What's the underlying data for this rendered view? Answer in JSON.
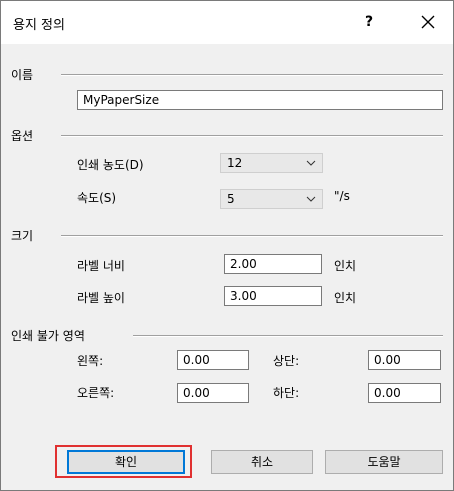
{
  "window": {
    "title": "용지 정의",
    "help_label": "?"
  },
  "name_section": {
    "title": "이름",
    "name_value": "MyPaperSize"
  },
  "options_section": {
    "title": "옵션",
    "darkness": {
      "label": "인쇄 농도(D)",
      "value": "12"
    },
    "speed": {
      "label": "속도(S)",
      "value": "5",
      "unit": "\"/s"
    }
  },
  "size_section": {
    "title": "크기",
    "width": {
      "label": "라벨 너비",
      "value": "2.00",
      "unit": "인치"
    },
    "height": {
      "label": "라벨 높이",
      "value": "3.00",
      "unit": "인치"
    }
  },
  "unprintable_section": {
    "title": "인쇄 불가 영역",
    "left": {
      "label": "왼쪽:",
      "value": "0.00"
    },
    "right": {
      "label": "오른쪽:",
      "value": "0.00"
    },
    "top": {
      "label": "상단:",
      "value": "0.00"
    },
    "bottom": {
      "label": "하단:",
      "value": "0.00"
    }
  },
  "buttons": {
    "ok": "확인",
    "cancel": "취소",
    "help": "도움말"
  },
  "colors": {
    "focus": "#0078d7",
    "highlight": "#e03030"
  }
}
